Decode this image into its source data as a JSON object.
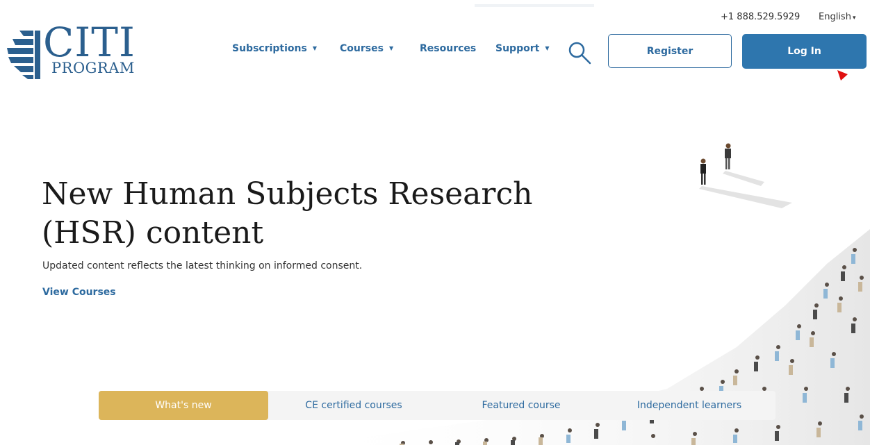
{
  "utility": {
    "phone": "+1 888.529.5929",
    "language": "English"
  },
  "logo": {
    "word": "CITI",
    "sub": "PROGRAM"
  },
  "nav": {
    "subscriptions": "Subscriptions",
    "courses": "Courses",
    "resources": "Resources",
    "support": "Support"
  },
  "actions": {
    "register": "Register",
    "login": "Log In"
  },
  "hero": {
    "title_line1": "New Human Subjects Research",
    "title_line2": "(HSR) content",
    "subtitle": "Updated content reflects the latest thinking on informed consent.",
    "link": "View Courses"
  },
  "tabs": [
    {
      "label": "What's new",
      "active": true
    },
    {
      "label": "CE certified courses",
      "active": false
    },
    {
      "label": "Featured course",
      "active": false
    },
    {
      "label": "Independent learners",
      "active": false
    }
  ],
  "colors": {
    "brand_blue": "#2d6a9f",
    "login_bg": "#2e76ae",
    "active_tab": "#dcb55a"
  },
  "icons": [
    "search-icon",
    "chevron-down-icon",
    "logo-mark-icon",
    "cursor-icon"
  ]
}
